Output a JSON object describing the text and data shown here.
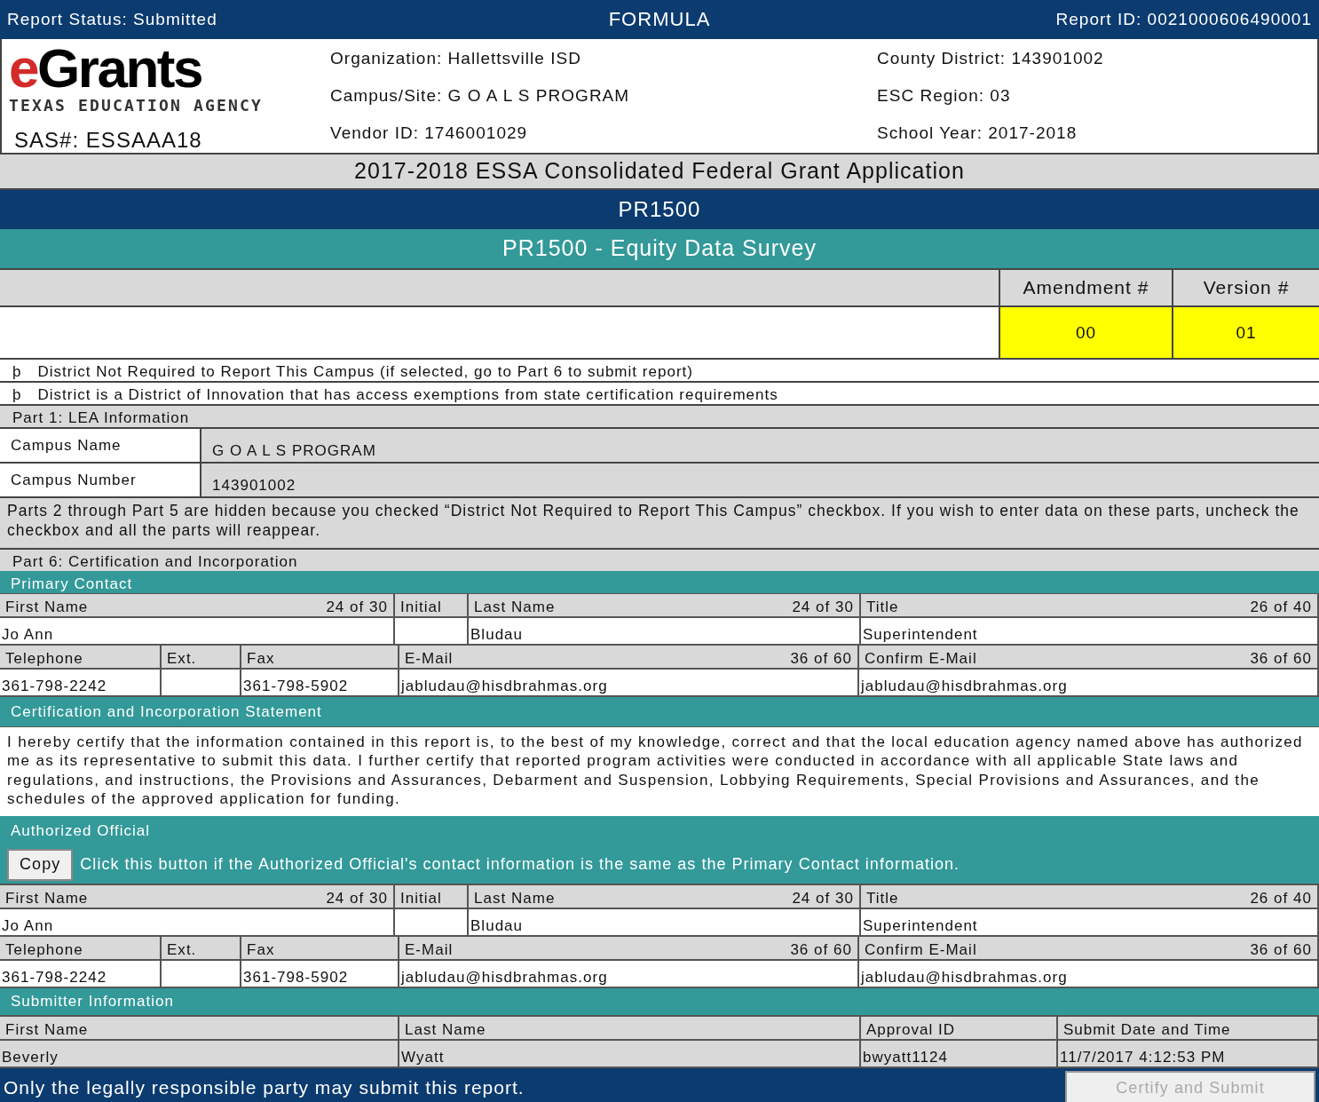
{
  "top_bar": {
    "status": "Report Status: Submitted",
    "title": "FORMULA",
    "report_id": "Report ID: 0021000606490001"
  },
  "logo": {
    "wordmark": "eGrants",
    "agency": "TEXAS EDUCATION AGENCY"
  },
  "sas": "SAS#: ESSAAA18",
  "info": [
    [
      "Organization: Hallettsville ISD",
      "Campus/Site: G O A L S PROGRAM",
      "Vendor ID: 1746001029"
    ],
    [
      "County District: 143901002",
      "ESC Region: 03",
      "School Year: 2017-2018"
    ]
  ],
  "application_title": "2017-2018 ESSA Consolidated Federal Grant Application",
  "schedule": "PR1500",
  "schedule_title": "PR1500 - Equity Data Survey",
  "amendment": {
    "label": "Amendment #",
    "value": "00"
  },
  "version": {
    "label": "Version #",
    "value": "01"
  },
  "checkboxes": [
    {
      "glyph": "þ",
      "label": "District Not Required to Report This Campus (if selected, go to Part 6 to submit report)"
    },
    {
      "glyph": "þ",
      "label": "District is a District of Innovation that has access exemptions from state certification requirements"
    }
  ],
  "part1": {
    "title": "Part 1: LEA Information",
    "rows": [
      {
        "label": "Campus Name",
        "value": "G O A L S PROGRAM"
      },
      {
        "label": "Campus Number",
        "value": "143901002"
      }
    ]
  },
  "hidden_note": "Parts 2 through Part 5 are hidden because you checked “District Not Required to Report This Campus” checkbox. If you wish to enter data on these parts, uncheck the checkbox and all the parts will reappear.",
  "part6": {
    "title": "Part 6: Certification and Incorporation"
  },
  "primary_contact": {
    "title": "Primary Contact",
    "name_fields": [
      {
        "label": "First Name",
        "count": "24 of 30",
        "value": "Jo Ann"
      },
      {
        "label": "Initial"
      },
      {
        "label": "Last Name",
        "count": "24 of 30",
        "value": "Bludau"
      },
      {
        "label": "Title",
        "count": "26 of 40",
        "value": "Superintendent"
      }
    ],
    "contact_fields": [
      {
        "label": "Telephone",
        "value": "361-798-2242"
      },
      {
        "label": "Ext."
      },
      {
        "label": "Fax",
        "value": "361-798-5902"
      },
      {
        "label": "E-Mail",
        "count": "36 of 60",
        "value": "jabludau@hisdbrahmas.org"
      },
      {
        "label": "Confirm E-Mail",
        "count": "36 of 60",
        "value": "jabludau@hisdbrahmas.org"
      }
    ]
  },
  "certification": {
    "title": "Certification and Incorporation Statement",
    "text": "I hereby certify that the information contained in this report is, to the best of my knowledge, correct and that the local education agency named above has authorized me as its representative to submit this data. I further certify that reported program activities were conducted in accordance with all applicable State laws and regulations, and instructions, the Provisions and Assurances, Debarment and Suspension, Lobbying Requirements, Special Provisions and Assurances, and the schedules of the approved application for funding."
  },
  "authorized_official": {
    "title": "Authorized Official",
    "copy_button": "Copy",
    "copy_hint": "Click this button if the Authorized Official's contact information is the same as the Primary Contact information.",
    "name_fields": [
      {
        "label": "First Name",
        "count": "24 of 30",
        "value": "Jo Ann"
      },
      {
        "label": "Initial"
      },
      {
        "label": "Last Name",
        "count": "24 of 30",
        "value": "Bludau"
      },
      {
        "label": "Title",
        "count": "26 of 40",
        "value": "Superintendent"
      }
    ],
    "contact_fields": [
      {
        "label": "Telephone",
        "value": "361-798-2242"
      },
      {
        "label": "Ext."
      },
      {
        "label": "Fax",
        "value": "361-798-5902"
      },
      {
        "label": "E-Mail",
        "count": "36 of 60",
        "value": "jabludau@hisdbrahmas.org"
      },
      {
        "label": "Confirm E-Mail",
        "count": "36 of 60",
        "value": "jabludau@hisdbrahmas.org"
      }
    ]
  },
  "submitter": {
    "title": "Submitter Information",
    "columns": [
      {
        "label": "First Name",
        "value": "Beverly"
      },
      {
        "label": "Last Name",
        "value": "Wyatt"
      },
      {
        "label": "Approval ID",
        "value": "bwyatt1124"
      },
      {
        "label": "Submit Date and Time",
        "value": "11/7/2017 4:12:53 PM"
      }
    ]
  },
  "footer": {
    "note": "Only the legally responsible party may submit this report.",
    "submit_button": "Certify and Submit",
    "submit_disabled": true
  }
}
